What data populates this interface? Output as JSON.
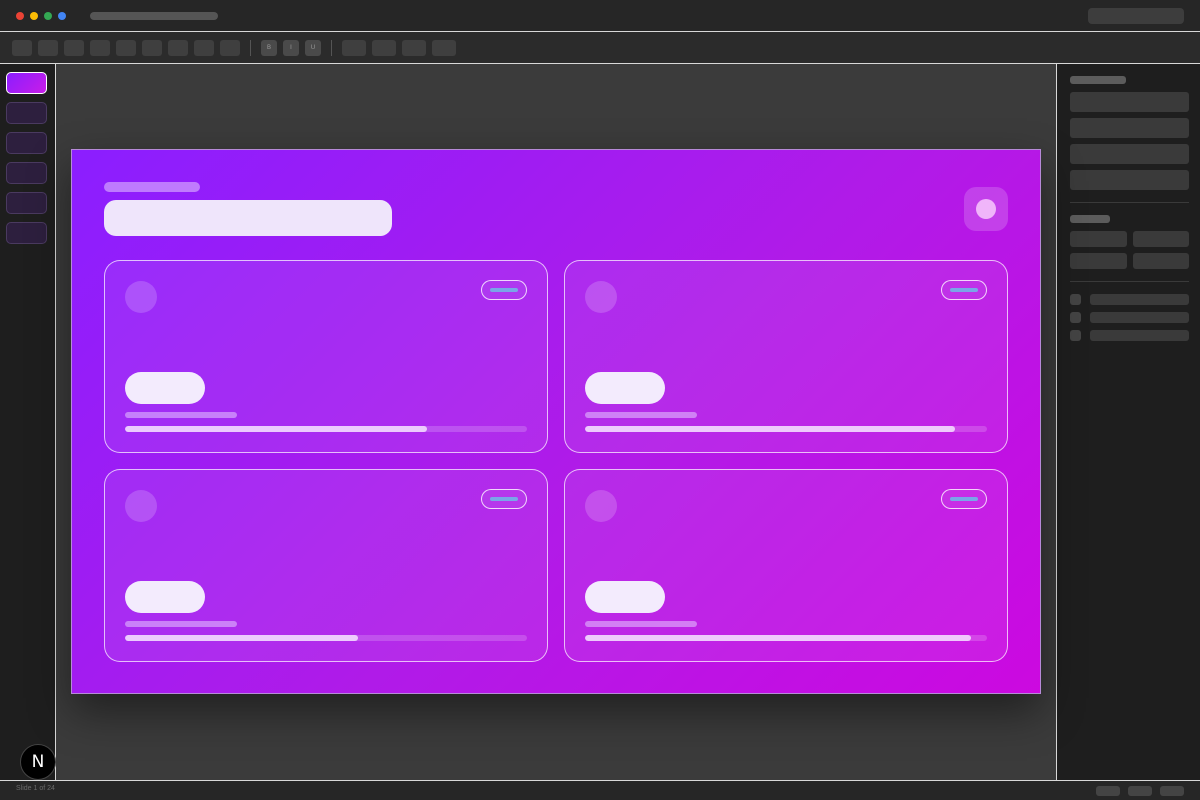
{
  "window": {
    "traffic_light_colors": [
      "#ea4335",
      "#fbbc05",
      "#34a853",
      "#4285f4"
    ]
  },
  "toolbar": {
    "format_labels": [
      "B",
      "I",
      "U"
    ]
  },
  "status_bar": {
    "slide_indicator": "Slide 1 of 24"
  },
  "floating_badge": {
    "letter": "N"
  },
  "slide": {
    "gradient_colors": [
      "#8b1eff",
      "#cc09e0"
    ],
    "cards": [
      {
        "progress": 0.75
      },
      {
        "progress": 0.92
      },
      {
        "progress": 0.58
      },
      {
        "progress": 0.96
      }
    ]
  }
}
